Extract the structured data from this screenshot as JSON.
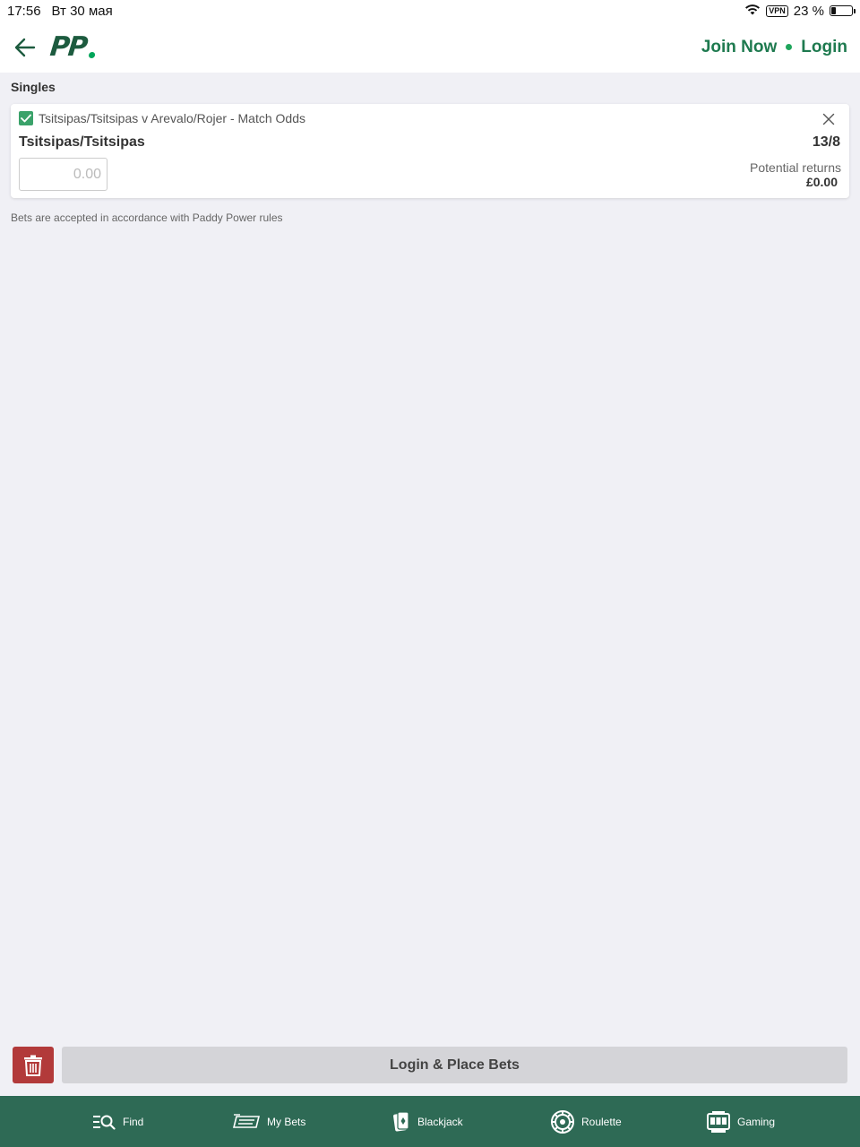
{
  "status_bar": {
    "time": "17:56",
    "date": "Вт 30 мая",
    "vpn": "VPN",
    "battery": "23 %"
  },
  "header": {
    "logo_text": "PP",
    "join_label": "Join Now",
    "login_label": "Login"
  },
  "betslip": {
    "section_title": "Singles",
    "event": "Tsitsipas/Tsitsipas v Arevalo/Rojer - Match Odds",
    "selection": "Tsitsipas/Tsitsipas",
    "odds": "13/8",
    "stake_placeholder": "0.00",
    "returns_label": "Potential returns",
    "returns_value": "£0.00",
    "rules_note": "Bets are accepted in accordance with Paddy Power rules"
  },
  "actions": {
    "place_bets_label": "Login & Place Bets"
  },
  "bottom_nav": {
    "items": [
      {
        "label": "Find",
        "icon": "find-icon"
      },
      {
        "label": "My Bets",
        "icon": "my-bets-icon"
      },
      {
        "label": "Blackjack",
        "icon": "blackjack-icon"
      },
      {
        "label": "Roulette",
        "icon": "roulette-icon"
      },
      {
        "label": "Gaming",
        "icon": "gaming-icon"
      }
    ]
  },
  "colors": {
    "brand_green": "#1d5b3f",
    "link_green": "#1e7a4f",
    "nav_bg": "#2e6a55",
    "delete_red": "#b23a3a"
  }
}
